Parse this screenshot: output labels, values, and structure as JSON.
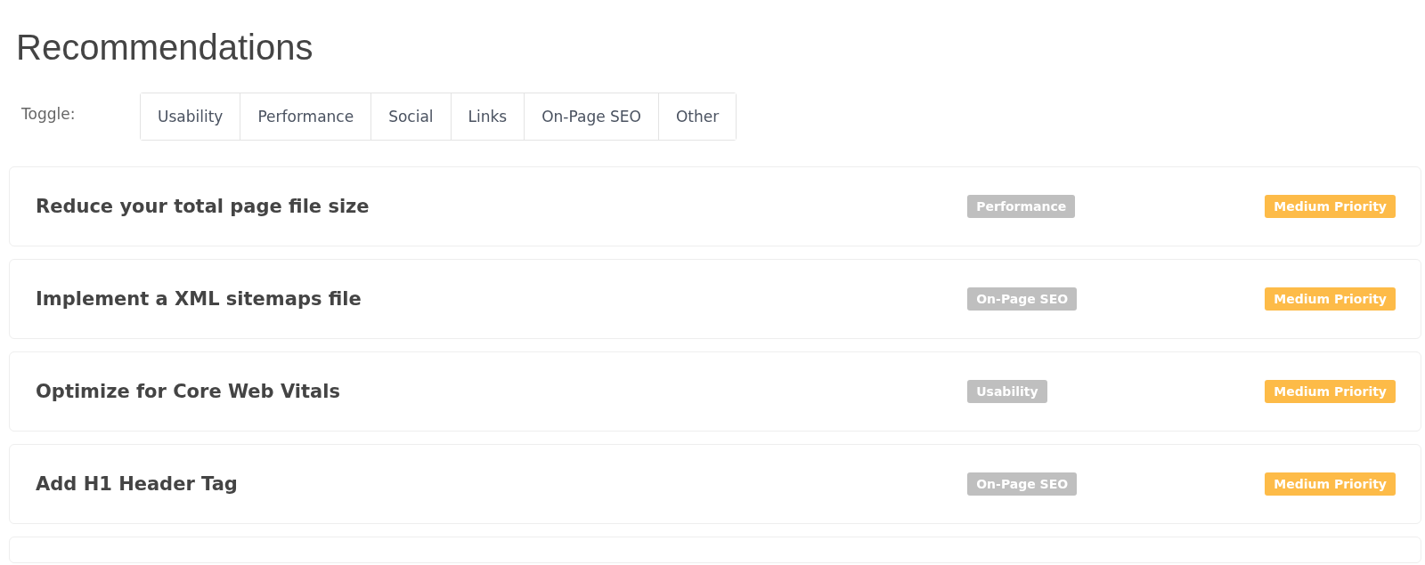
{
  "title": "Recommendations",
  "toggle": {
    "label": "Toggle:",
    "options": [
      {
        "label": "Usability",
        "selected": false
      },
      {
        "label": "Performance",
        "selected": false
      },
      {
        "label": "Social",
        "selected": false
      },
      {
        "label": "Links",
        "selected": false
      },
      {
        "label": "On-Page SEO",
        "selected": false
      },
      {
        "label": "Other",
        "selected": false
      }
    ]
  },
  "recommendations": [
    {
      "title": "Reduce your total page file size",
      "category": "Performance",
      "priority": "Medium Priority"
    },
    {
      "title": "Implement a XML sitemaps file",
      "category": "On-Page SEO",
      "priority": "Medium Priority"
    },
    {
      "title": "Optimize for Core Web Vitals",
      "category": "Usability",
      "priority": "Medium Priority"
    },
    {
      "title": "Add H1 Header Tag",
      "category": "On-Page SEO",
      "priority": "Medium Priority"
    }
  ]
}
